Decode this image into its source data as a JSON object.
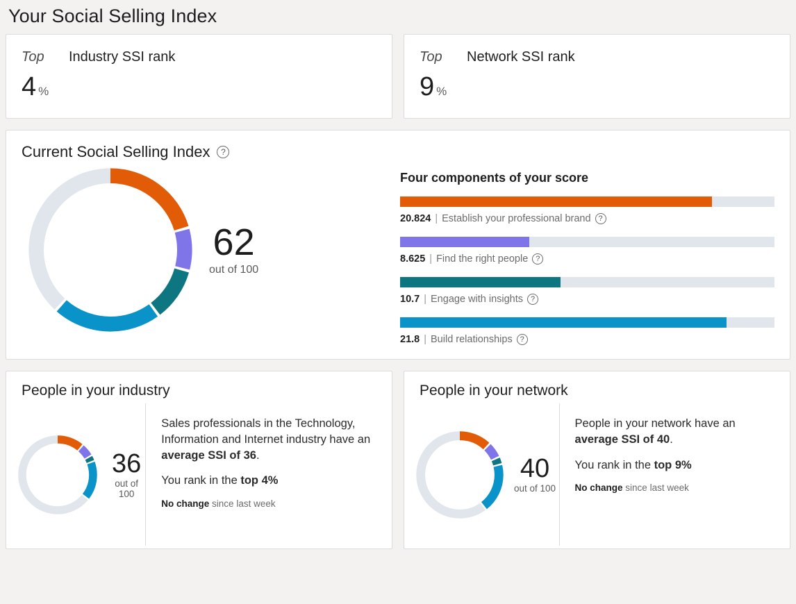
{
  "page": {
    "title": "Your Social Selling Index"
  },
  "colors": {
    "brand_orange": "#e25b07",
    "brand_purple": "#7f74e8",
    "brand_teal": "#0e7680",
    "brand_blue": "#0a93c8",
    "track_gray": "#e1e6ec",
    "page_background": "#f3f2f1",
    "card_background": "#ffffff",
    "card_border": "#dcdcdc"
  },
  "rank_cards": [
    {
      "top_word": "Top",
      "title": "Industry SSI rank",
      "value": "4",
      "unit": "%"
    },
    {
      "top_word": "Top",
      "title": "Network SSI rank",
      "value": "9",
      "unit": "%"
    }
  ],
  "current_ssi": {
    "title": "Current Social Selling Index",
    "help_icon": "question-circle-icon",
    "score": "62",
    "score_sub": "out of 100",
    "components_title": "Four components of your score",
    "components": [
      {
        "value": "20.824",
        "separator": "|",
        "label": "Establish your professional brand",
        "color": "#e25b07",
        "max": 25,
        "help_icon": "question-circle-icon"
      },
      {
        "value": "8.625",
        "separator": "|",
        "label": "Find the right people",
        "color": "#7f74e8",
        "max": 25,
        "help_icon": "question-circle-icon"
      },
      {
        "value": "10.7",
        "separator": "|",
        "label": "Engage with insights",
        "color": "#0e7680",
        "max": 25,
        "help_icon": "question-circle-icon"
      },
      {
        "value": "21.8",
        "separator": "|",
        "label": "Build relationships",
        "color": "#0a93c8",
        "max": 25,
        "help_icon": "question-circle-icon"
      }
    ]
  },
  "people_industry": {
    "title": "People in your industry",
    "score": "36",
    "score_sub": "out of 100",
    "paragraph_1_prefix": "Sales professionals in the Technology, Information and Internet industry have an ",
    "paragraph_1_bold": "average SSI of 36",
    "paragraph_1_suffix": ".",
    "paragraph_2_prefix": "You rank in the ",
    "paragraph_2_bold": "top 4%",
    "note_bold": "No change",
    "note_rest": " since last week"
  },
  "people_network": {
    "title": "People in your network",
    "score": "40",
    "score_sub": "out of 100",
    "paragraph_1_prefix": "People in your network have an ",
    "paragraph_1_bold": "average SSI of 40",
    "paragraph_1_suffix": ".",
    "paragraph_2_prefix": "You rank in the ",
    "paragraph_2_bold": "top 9%",
    "note_bold": "No change",
    "note_rest": " since last week"
  },
  "chart_data": [
    {
      "type": "pie",
      "title": "Current Social Selling Index",
      "total": 100,
      "center_label": "62",
      "center_sublabel": "out of 100",
      "slices": [
        {
          "name": "Establish your professional brand",
          "value": 20.824,
          "color": "#e25b07"
        },
        {
          "name": "Find the right people",
          "value": 8.625,
          "color": "#7f74e8"
        },
        {
          "name": "Engage with insights",
          "value": 10.7,
          "color": "#0e7680"
        },
        {
          "name": "Build relationships",
          "value": 21.8,
          "color": "#0a93c8"
        },
        {
          "name": "Remaining",
          "value": 38.051,
          "color": "#e1e6ec"
        }
      ]
    },
    {
      "type": "bar",
      "title": "Four components of your score",
      "orientation": "horizontal",
      "categories": [
        "Establish your professional brand",
        "Find the right people",
        "Engage with insights",
        "Build relationships"
      ],
      "values": [
        20.824,
        8.625,
        10.7,
        21.8
      ],
      "xlim": [
        0,
        25
      ],
      "colors": [
        "#e25b07",
        "#7f74e8",
        "#0e7680",
        "#0a93c8"
      ],
      "grid": false,
      "legend": "none"
    },
    {
      "type": "pie",
      "title": "People in your industry",
      "total": 100,
      "center_label": "36",
      "center_sublabel": "out of 100",
      "slices": [
        {
          "name": "Establish your professional brand",
          "value": 11.5,
          "color": "#e25b07"
        },
        {
          "name": "Find the right people",
          "value": 5.5,
          "color": "#7f74e8"
        },
        {
          "name": "Engage with insights",
          "value": 2.5,
          "color": "#0e7680"
        },
        {
          "name": "Build relationships",
          "value": 16.5,
          "color": "#0a93c8"
        },
        {
          "name": "Remaining",
          "value": 64,
          "color": "#e1e6ec"
        }
      ]
    },
    {
      "type": "pie",
      "title": "People in your network",
      "total": 100,
      "center_label": "40",
      "center_sublabel": "out of 100",
      "slices": [
        {
          "name": "Establish your professional brand",
          "value": 12.5,
          "color": "#e25b07"
        },
        {
          "name": "Find the right people",
          "value": 6.0,
          "color": "#7f74e8"
        },
        {
          "name": "Engage with insights",
          "value": 2.8,
          "color": "#0e7680"
        },
        {
          "name": "Build relationships",
          "value": 18.7,
          "color": "#0a93c8"
        },
        {
          "name": "Remaining",
          "value": 60,
          "color": "#e1e6ec"
        }
      ]
    }
  ]
}
